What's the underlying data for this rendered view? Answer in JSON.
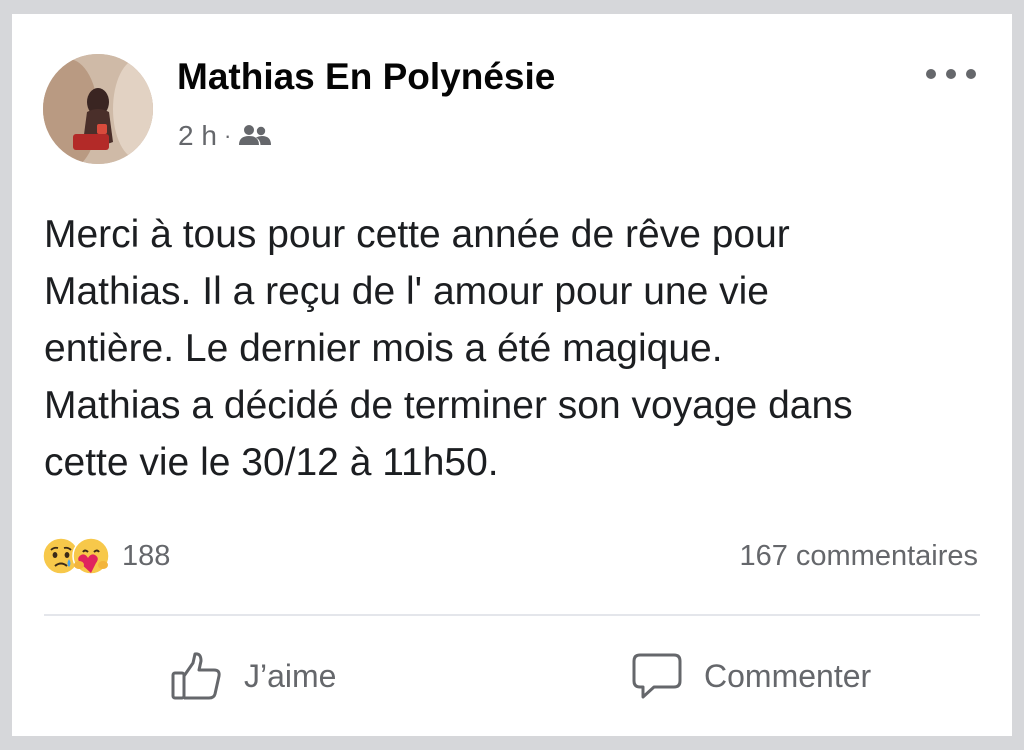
{
  "post": {
    "author": "Mathias En Polynésie",
    "time": "2 h",
    "separator": "·",
    "audience_icon": "friends-icon",
    "more_icon": "more-options-icon",
    "text_lines": [
      "Merci à tous pour cette année de rêve pour",
      "Mathias. Il a reçu de l' amour pour une vie",
      "entière. Le dernier mois a été magique.",
      "Mathias a décidé de terminer son voyage dans",
      "cette vie le 30/12 à 11h50."
    ]
  },
  "stats": {
    "reaction_icons": [
      "sad-reaction-icon",
      "care-reaction-icon"
    ],
    "reaction_count": "188",
    "comments": "167 commentaires"
  },
  "actions": {
    "like_label": "J’aime",
    "comment_label": "Commenter"
  },
  "colors": {
    "text": "#1c1e21",
    "secondary": "#65676b",
    "divider": "#e4e6eb",
    "frame": "#d6d7da"
  }
}
